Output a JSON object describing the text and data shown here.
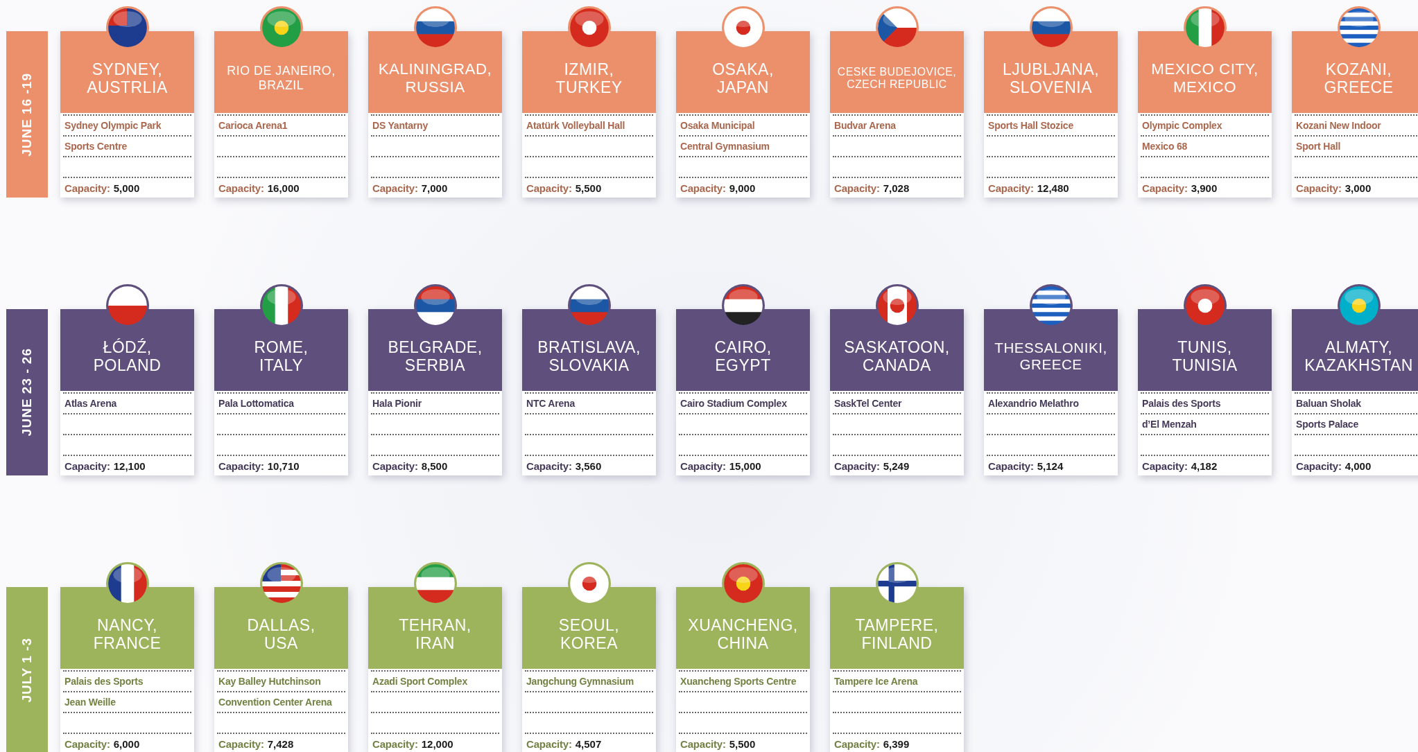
{
  "groups": [
    {
      "dates": "JUNE 16 -19",
      "color": "#ec8f6b",
      "cards": [
        {
          "city": [
            "SYDNEY,",
            "AUSTRLIA"
          ],
          "venue": [
            "Sydney Olympic Park",
            "Sports Centre"
          ],
          "capacity_label": "Capacity:",
          "capacity": "5,000"
        },
        {
          "city": [
            "RIO DE JANEIRO,",
            "BRAZIL"
          ],
          "venue": [
            "Carioca Arena1"
          ],
          "capacity_label": "Capacity:",
          "capacity": "16,000"
        },
        {
          "city": [
            "KALININGRAD,",
            "RUSSIA"
          ],
          "venue": [
            "DS Yantarny"
          ],
          "capacity_label": "Capacity:",
          "capacity": "7,000"
        },
        {
          "city": [
            "IZMIR,",
            "TURKEY"
          ],
          "venue": [
            "Atatürk Volleyball Hall"
          ],
          "capacity_label": "Capacity:",
          "capacity": "5,500"
        },
        {
          "city": [
            "OSAKA,",
            "JAPAN"
          ],
          "venue": [
            "Osaka Municipal",
            "Central Gymnasium"
          ],
          "capacity_label": "Capacity:",
          "capacity": "9,000"
        },
        {
          "city": [
            "CESKE BUDEJOVICE,",
            "CZECH REPUBLIC"
          ],
          "venue": [
            "Budvar Arena"
          ],
          "capacity_label": "Capacity:",
          "capacity": "7,028"
        },
        {
          "city": [
            "LJUBLJANA,",
            "SLOVENIA"
          ],
          "venue": [
            "Sports Hall Stozice"
          ],
          "capacity_label": "Capacity:",
          "capacity": "12,480"
        },
        {
          "city": [
            "MEXICO CITY,",
            "MEXICO"
          ],
          "venue": [
            "Olympic Complex",
            "Mexico 68"
          ],
          "capacity_label": "Capacity:",
          "capacity": "3,900"
        },
        {
          "city": [
            "KOZANI,",
            "GREECE"
          ],
          "venue": [
            "Kozani New Indoor",
            "Sport Hall"
          ],
          "capacity_label": "Capacity:",
          "capacity": "3,000"
        }
      ]
    },
    {
      "dates": "JUNE 23 - 26",
      "color": "#5f4f7c",
      "cards": [
        {
          "city": [
            "ŁÓDŹ,",
            "POLAND"
          ],
          "venue": [
            "Atlas Arena"
          ],
          "capacity_label": "Capacity:",
          "capacity": "12,100"
        },
        {
          "city": [
            "ROME,",
            "ITALY"
          ],
          "venue": [
            "Pala Lottomatica"
          ],
          "capacity_label": "Capacity:",
          "capacity": "10,710"
        },
        {
          "city": [
            "BELGRADE,",
            "SERBIA"
          ],
          "venue": [
            "Hala Pionir"
          ],
          "capacity_label": "Capacity:",
          "capacity": "8,500"
        },
        {
          "city": [
            "BRATISLAVA,",
            "SLOVAKIA"
          ],
          "venue": [
            "NTC Arena"
          ],
          "capacity_label": "Capacity:",
          "capacity": "3,560"
        },
        {
          "city": [
            "CAIRO,",
            "EGYPT"
          ],
          "venue": [
            "Cairo Stadium Complex"
          ],
          "capacity_label": "Capacity:",
          "capacity": "15,000"
        },
        {
          "city": [
            "SASKATOON,",
            "CANADA"
          ],
          "venue": [
            "SaskTel Center"
          ],
          "capacity_label": "Capacity:",
          "capacity": "5,249"
        },
        {
          "city": [
            "THESSALONIKI,",
            "GREECE"
          ],
          "venue": [
            "Alexandrio Melathro"
          ],
          "capacity_label": "Capacity:",
          "capacity": "5,124"
        },
        {
          "city": [
            "TUNIS,",
            "TUNISIA"
          ],
          "venue": [
            "Palais des Sports",
            "d’El Menzah"
          ],
          "capacity_label": "Capacity:",
          "capacity": "4,182"
        },
        {
          "city": [
            "ALMATY,",
            "KAZAKHSTAN"
          ],
          "venue": [
            "Baluan Sholak",
            "Sports Palace"
          ],
          "capacity_label": "Capacity:",
          "capacity": "4,000"
        }
      ]
    },
    {
      "dates": "JULY 1 -3",
      "color": "#9db45c",
      "cards": [
        {
          "city": [
            "NANCY,",
            "FRANCE"
          ],
          "venue": [
            "Palais des Sports",
            "Jean Weille"
          ],
          "capacity_label": "Capacity:",
          "capacity": "6,000"
        },
        {
          "city": [
            "DALLAS,",
            "USA"
          ],
          "venue": [
            "Kay Balley Hutchinson",
            "Convention Center Arena"
          ],
          "capacity_label": "Capacity:",
          "capacity": "7,428"
        },
        {
          "city": [
            "TEHRAN,",
            "IRAN"
          ],
          "venue": [
            "Azadi Sport Complex"
          ],
          "capacity_label": "Capacity:",
          "capacity": "12,000"
        },
        {
          "city": [
            "SEOUL,",
            "KOREA"
          ],
          "venue": [
            "Jangchung Gymnasium"
          ],
          "capacity_label": "Capacity:",
          "capacity": "4,507"
        },
        {
          "city": [
            "XUANCHENG,",
            "CHINA"
          ],
          "venue": [
            "Xuancheng Sports Centre"
          ],
          "capacity_label": "Capacity:",
          "capacity": "5,500"
        },
        {
          "city": [
            "TAMPERE,",
            "FINLAND"
          ],
          "venue": [
            "Tampere Ice Arena"
          ],
          "capacity_label": "Capacity:",
          "capacity": "6,399"
        }
      ]
    }
  ]
}
